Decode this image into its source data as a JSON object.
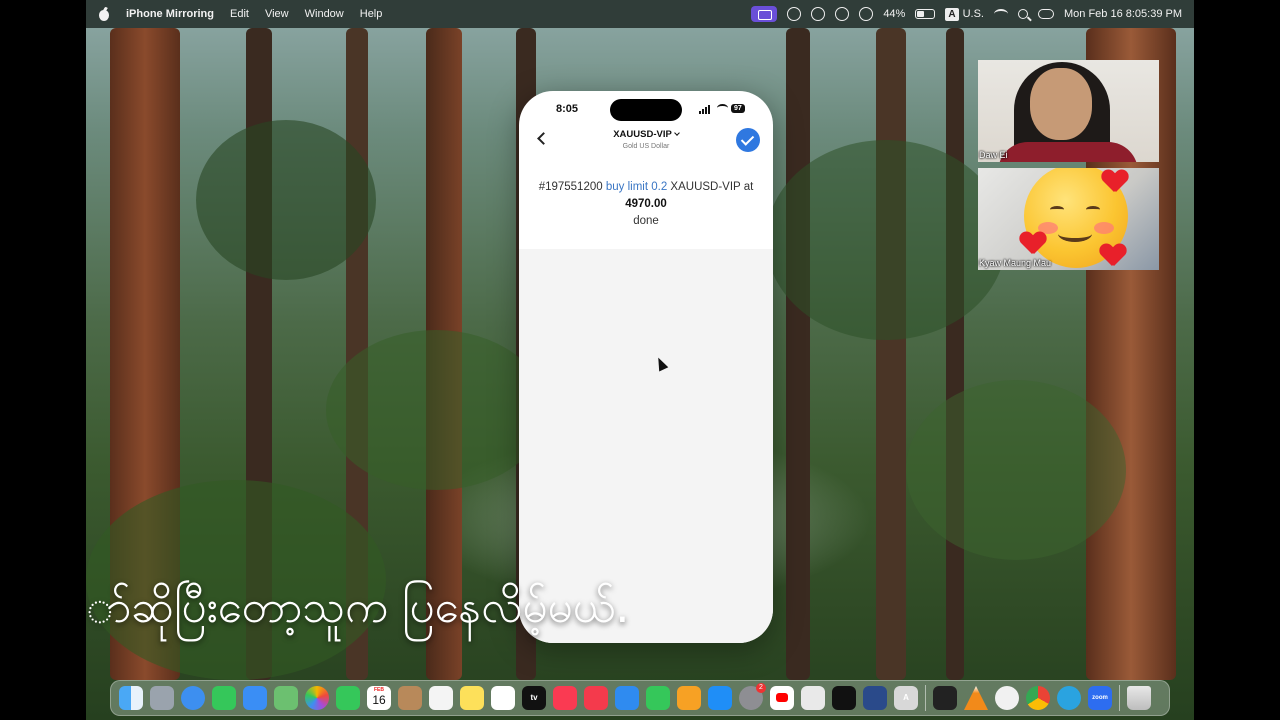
{
  "menubar": {
    "app_name": "iPhone Mirroring",
    "menus": [
      "Edit",
      "View",
      "Window",
      "Help"
    ],
    "battery_percent": "44%",
    "battery_level": 0.44,
    "input_source_badge": "A",
    "input_source": "U.S.",
    "datetime": "Mon Feb 16  8:05:39 PM"
  },
  "phone": {
    "status_time": "8:05",
    "battery": "97",
    "nav_title": "XAUUSD-VIP",
    "nav_subtitle": "Gold US Dollar",
    "order_id": "#197551200",
    "order_type": "buy limit 0.2",
    "order_symbol": "XAUUSD-VIP at",
    "order_price": "4970.00",
    "order_status": "done"
  },
  "participants": [
    {
      "name": "Daw Ei"
    },
    {
      "name": "Kyaw Maung Mau"
    }
  ],
  "subtitle": "ာ်ဆိုပြီးတော့သူက                                   ပြနေလိမ့်မယ်.",
  "dock": {
    "calendar_month": "FEB",
    "calendar_day": "16",
    "settings_badge": "2",
    "font_app_label": "A",
    "zoom_label": "zoom",
    "tv_label": "tv"
  },
  "colors": {
    "menubar": "#283430",
    "mirroring_accent": "#6a4fd8",
    "link_blue": "#3a76c4",
    "confirm_blue": "#2f78e0"
  }
}
